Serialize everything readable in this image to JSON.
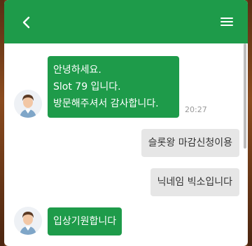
{
  "header": {
    "back_icon": "chevron-left-icon",
    "menu_icon": "hamburger-menu-icon",
    "color": "#1e9b4a"
  },
  "messages": [
    {
      "direction": "incoming",
      "lines": [
        "안녕하세요.",
        "Slot 79 입니다.",
        "방문해주셔서 감사합니다."
      ],
      "time": "20:27"
    },
    {
      "direction": "outgoing",
      "text": "슬롯왕 마감신청이용"
    },
    {
      "direction": "outgoing",
      "text": "닉네임 빅소입니다"
    },
    {
      "direction": "incoming",
      "text": "입상기원합니다"
    }
  ]
}
